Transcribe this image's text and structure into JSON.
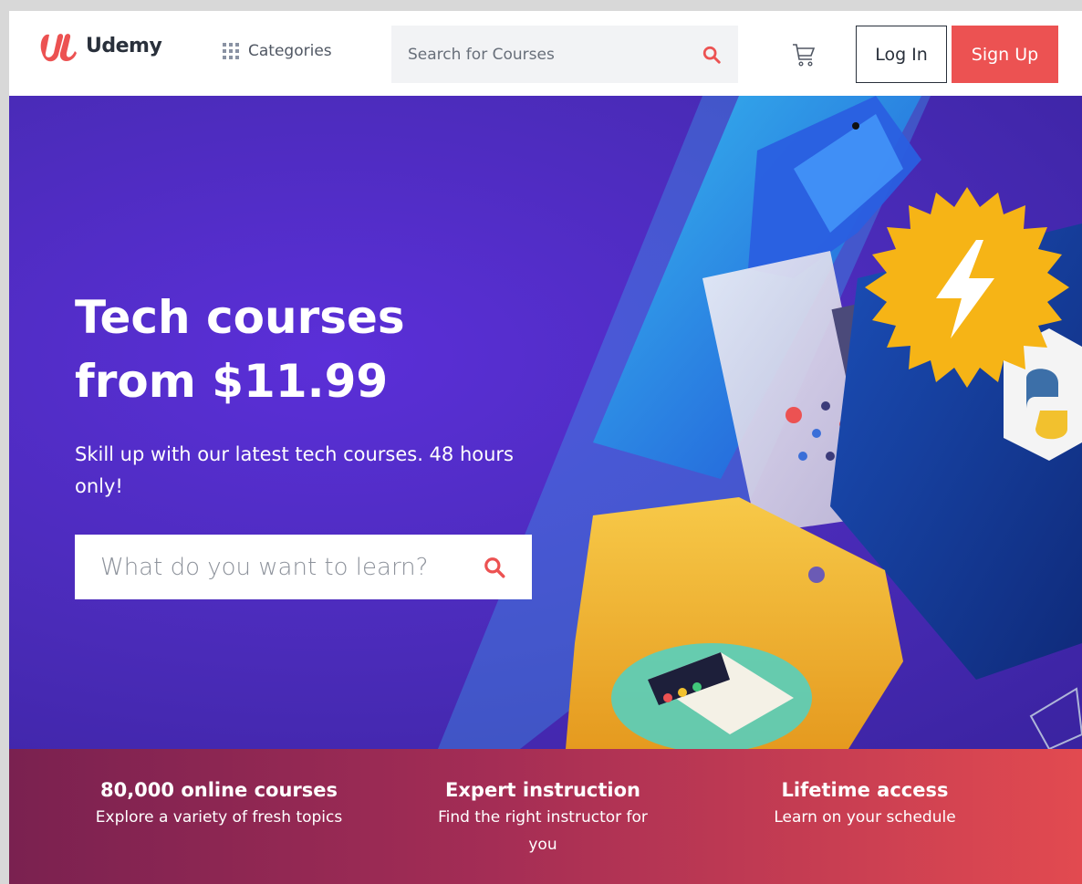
{
  "header": {
    "brand": "Udemy",
    "categories_label": "Categories",
    "search_placeholder": "Search for Courses",
    "login_label": "Log In",
    "signup_label": "Sign Up"
  },
  "hero": {
    "title_line1": "Tech courses",
    "title_line2": "from $11.99",
    "subtitle": "Skill up with our latest tech courses. 48 hours only!",
    "search_placeholder": "What do you want to learn?"
  },
  "value_props": [
    {
      "title": "80,000 online courses",
      "desc": "Explore a variety of fresh topics"
    },
    {
      "title": "Expert instruction",
      "desc": "Find the right instructor for you"
    },
    {
      "title": "Lifetime access",
      "desc": "Learn on your schedule"
    }
  ],
  "colors": {
    "brand_red": "#ec5252",
    "hero_purple": "#4a2bb8",
    "text_dark": "#29303b"
  },
  "icons": {
    "logo": "udemy-logo-icon",
    "categories": "grid-icon",
    "search": "search-icon",
    "cart": "cart-icon"
  }
}
